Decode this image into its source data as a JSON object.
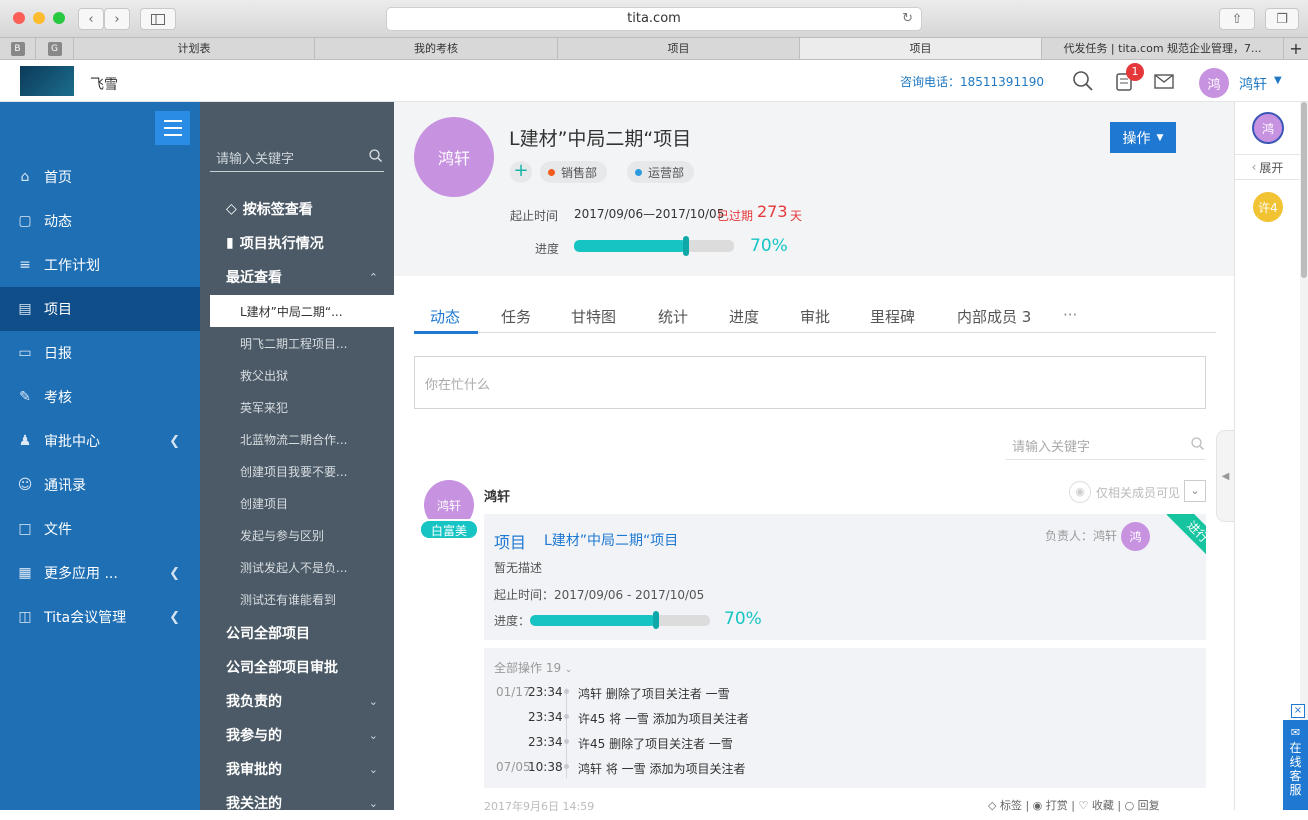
{
  "browser": {
    "url": "tita.com",
    "tabs": [
      "计划表",
      "我的考核",
      "项目",
      "项目",
      "代发任务 | tita.com 规范企业管理，7..."
    ],
    "favicons": [
      "B",
      "G"
    ]
  },
  "header": {
    "company": "飞雪",
    "hotline": "咨询电话：18511391190",
    "notif_count": "1",
    "user_avatar": "鸿",
    "user_name": "鸿轩"
  },
  "leftnav": {
    "items": [
      {
        "label": "首页",
        "icon": "home-icon"
      },
      {
        "label": "动态",
        "icon": "chat-icon"
      },
      {
        "label": "工作计划",
        "icon": "list-icon"
      },
      {
        "label": "项目",
        "icon": "project-icon"
      },
      {
        "label": "日报",
        "icon": "report-icon"
      },
      {
        "label": "考核",
        "icon": "edit-icon"
      },
      {
        "label": "审批中心",
        "icon": "stamp-icon"
      },
      {
        "label": "通讯录",
        "icon": "contacts-icon"
      },
      {
        "label": "文件",
        "icon": "file-icon"
      },
      {
        "label": "更多应用 ...",
        "icon": "apps-icon"
      },
      {
        "label": "Tita会议管理",
        "icon": "meeting-icon"
      }
    ]
  },
  "subnav": {
    "search_placeholder": "请输入关键字",
    "by_tag": "按标签查看",
    "execution": "项目执行情况",
    "recent": "最近查看",
    "recent_items": [
      "L建材”中局二期“...",
      "明飞二期工程项目...",
      "救父出狱",
      "英军来犯",
      "北蓝物流二期合作...",
      "创建项目我要不要...",
      "创建项目",
      "发起与参与区别",
      "测试发起人不是负...",
      "测试还有谁能看到"
    ],
    "sections": [
      "公司全部项目",
      "公司全部项目审批",
      "我负责的",
      "我参与的",
      "我审批的",
      "我关注的"
    ]
  },
  "project": {
    "avatar": "鸿轩",
    "title": "L建材”中局二期“项目",
    "depts": [
      "销售部",
      "运营部"
    ],
    "dept_colors": [
      "#f25c1f",
      "#2d9ae0"
    ],
    "op_button": "操作",
    "time_label": "起止时间",
    "time_range": "2017/09/06—2017/10/05",
    "overdue_prefix": "已过期",
    "overdue_days": "273",
    "overdue_unit": "天",
    "progress_label": "进度",
    "progress": 0.7,
    "progress_text": "70%"
  },
  "main_tabs": [
    "动态",
    "任务",
    "甘特图",
    "统计",
    "进度",
    "审批",
    "里程碑",
    "内部成员 3",
    "···"
  ],
  "composer_placeholder": "你在忙什么",
  "feed_search_placeholder": "请输入关键字",
  "post": {
    "avatar": "鸿轩",
    "badge": "白富美",
    "author": "鸿轩",
    "visibility": "仅相关成员可见",
    "card_type": "项目",
    "card_title": "L建材”中局二期“项目",
    "owner_label": "负责人：鸿轩",
    "owner_avatar": "鸿",
    "status_ribbon": "进行中",
    "desc": "暂无描述",
    "time": "起止时间：2017/09/06 - 2017/10/05",
    "progress_label": "进度：",
    "progress": 0.7,
    "progress_text": "70%",
    "ops_header": "全部操作  19",
    "ops": [
      {
        "date": "01/17",
        "time": "23:34",
        "text": "鸿轩 删除了项目关注者 一雪"
      },
      {
        "date": "",
        "time": "23:34",
        "text": "许45 将 一雪 添加为项目关注者"
      },
      {
        "date": "",
        "time": "23:34",
        "text": "许45 删除了项目关注者 一雪"
      },
      {
        "date": "07/05",
        "time": "10:38",
        "text": "鸿轩 将 一雪 添加为项目关注者"
      }
    ],
    "footer_date": "2017年9月6日 14:59",
    "actions": [
      "标签",
      "打赏",
      "收藏",
      "回复"
    ]
  },
  "rightpanel": {
    "avatar": "鸿",
    "expand": "展开",
    "member": "许4"
  },
  "service": "在线客服"
}
